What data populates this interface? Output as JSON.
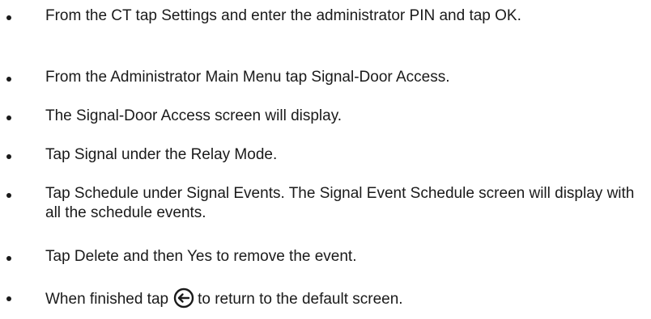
{
  "steps": [
    {
      "text": "From the CT tap Settings and enter the administrator PIN and tap OK."
    },
    {
      "text": "From the Administrator Main Menu tap Signal-Door Access."
    },
    {
      "text": "The Signal-Door Access screen will display."
    },
    {
      "text": "Tap Signal under the Relay Mode."
    },
    {
      "text": "Tap Schedule under Signal Events. The Signal Event Schedule screen will display with all the schedule events."
    },
    {
      "text": "Tap Delete and then Yes to remove the event."
    },
    {
      "text_before": "When finished tap",
      "icon": "back-arrow-circle-icon",
      "text_after": "to return to the default screen."
    }
  ]
}
